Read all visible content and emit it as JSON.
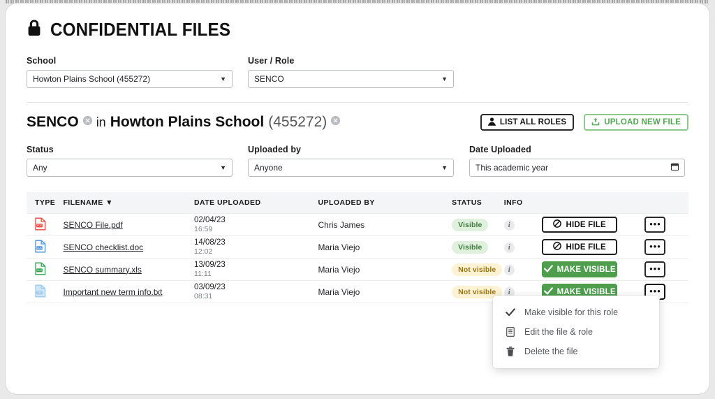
{
  "page": {
    "title": "CONFIDENTIAL FILES",
    "lock_icon": "lock-icon"
  },
  "top_filters": {
    "school": {
      "label": "School",
      "value": "Howton Plains School (455272)",
      "caret_icon": "chevron-down-icon"
    },
    "user_role": {
      "label": "User / Role",
      "value": "SENCO",
      "caret_icon": "chevron-down-icon"
    }
  },
  "role_header": {
    "role": "SENCO",
    "role_clear_icon": "close-circle-icon",
    "connector": "in",
    "school_name": "Howton Plains School",
    "school_number": "(455272)",
    "school_clear_icon": "close-circle-icon",
    "list_all_roles": {
      "label": "LIST ALL ROLES",
      "icon": "person-icon"
    },
    "upload_new_file": {
      "label": "UPLOAD NEW FILE",
      "icon": "upload-icon"
    }
  },
  "filters": {
    "status": {
      "label": "Status",
      "value": "Any",
      "caret_icon": "chevron-down-icon"
    },
    "uploaded_by": {
      "label": "Uploaded by",
      "value": "Anyone",
      "caret_icon": "chevron-down-icon"
    },
    "date_uploaded": {
      "label": "Date Uploaded",
      "value": "This academic year",
      "icon": "calendar-icon"
    }
  },
  "table": {
    "columns": {
      "type": "TYPE",
      "filename": "FILENAME",
      "filename_sort_icon": "sort-desc-icon",
      "date_uploaded": "DATE UPLOADED",
      "uploaded_by": "UPLOADED BY",
      "status": "STATUS",
      "info": "INFO"
    },
    "rows": [
      {
        "file_type": "pdf",
        "filename": "SENCO File.pdf",
        "date": "02/04/23",
        "time": "16:59",
        "uploaded_by": "Chris James",
        "status": "Visible",
        "info_icon": "info-icon",
        "action_label": "HIDE FILE",
        "action_icon": "block-icon",
        "kebab_icon": "more-options-icon"
      },
      {
        "file_type": "doc",
        "filename": "SENCO checklist.doc",
        "date": "14/08/23",
        "time": "12:02",
        "uploaded_by": "Maria Viejo",
        "status": "Visible",
        "info_icon": "info-icon",
        "action_label": "HIDE FILE",
        "action_icon": "block-icon",
        "kebab_icon": "more-options-icon"
      },
      {
        "file_type": "xls",
        "filename": "SENCO summary.xls",
        "date": "13/09/23",
        "time": "11:11",
        "uploaded_by": "Maria Viejo",
        "status": "Not visible",
        "info_icon": "info-icon",
        "action_label": "MAKE VISIBLE",
        "action_icon": "check-icon",
        "kebab_icon": "more-options-icon"
      },
      {
        "file_type": "txt",
        "filename": "Important new term info.txt",
        "date": "03/09/23",
        "time": "08:31",
        "uploaded_by": "Maria Viejo",
        "status": "Not visible",
        "info_icon": "info-icon",
        "action_label": "MAKE VISIBLE",
        "action_icon": "check-icon",
        "kebab_icon": "more-options-icon"
      }
    ]
  },
  "context_menu": {
    "items": [
      {
        "label": "Make visible for this role",
        "icon": "check-icon"
      },
      {
        "label": "Edit the file & role",
        "icon": "document-edit-icon"
      },
      {
        "label": "Delete the file",
        "icon": "trash-icon"
      }
    ]
  },
  "colors": {
    "green_solid": "#4e9e4e",
    "green_outline": "#8cc98c",
    "green_text": "#53a653",
    "pill_visible_bg": "#dff0dc",
    "pill_visible_text": "#3f7a3f",
    "pill_notvisible_bg": "#fdf2d4",
    "pill_notvisible_text": "#9a7516",
    "pdf_red": "#e8453c",
    "doc_blue": "#4a90d9",
    "xls_green": "#2fa14f",
    "txt_blue": "#9ec9e8"
  }
}
